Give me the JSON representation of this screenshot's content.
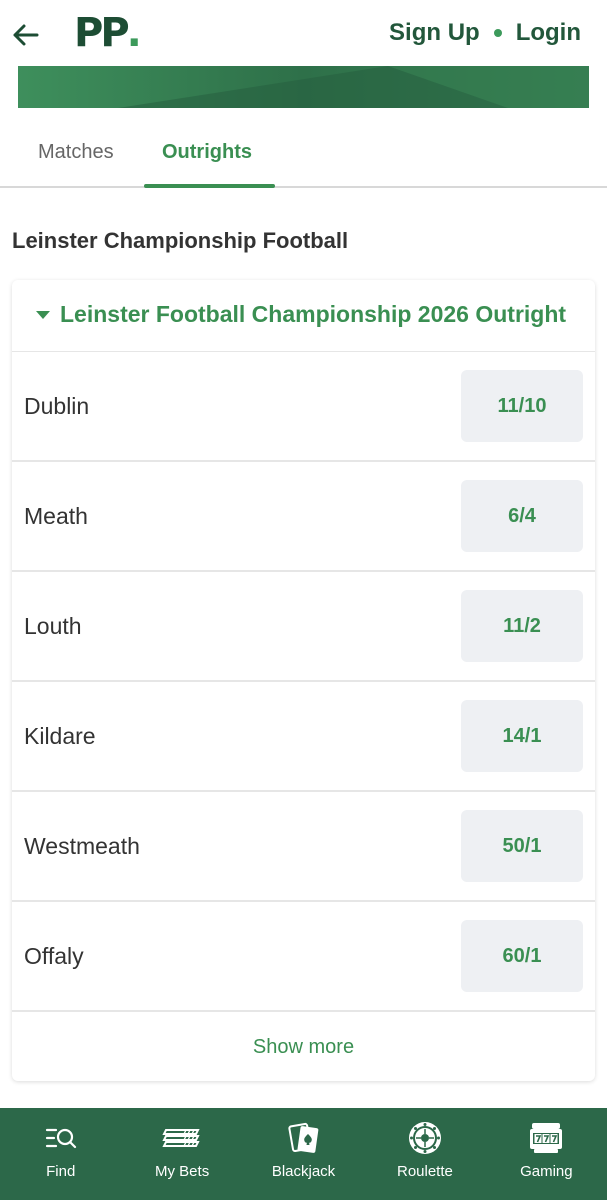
{
  "header": {
    "logo_text": "PP",
    "logo_dot": ".",
    "signup_label": "Sign Up",
    "login_label": "Login"
  },
  "tabs": [
    {
      "label": "Matches",
      "active": false
    },
    {
      "label": "Outrights",
      "active": true
    }
  ],
  "section_title": "Leinster Championship Football",
  "market": {
    "title": "Leinster Football Championship 2026 Outright",
    "selections": [
      {
        "name": "Dublin",
        "odds": "11/10"
      },
      {
        "name": "Meath",
        "odds": "6/4"
      },
      {
        "name": "Louth",
        "odds": "11/2"
      },
      {
        "name": "Kildare",
        "odds": "14/1"
      },
      {
        "name": "Westmeath",
        "odds": "50/1"
      },
      {
        "name": "Offaly",
        "odds": "60/1"
      }
    ],
    "show_more_label": "Show more"
  },
  "bottom_nav": [
    {
      "label": "Find",
      "icon": "find-icon"
    },
    {
      "label": "My Bets",
      "icon": "my-bets-icon"
    },
    {
      "label": "Blackjack",
      "icon": "blackjack-icon"
    },
    {
      "label": "Roulette",
      "icon": "roulette-icon"
    },
    {
      "label": "Gaming",
      "icon": "slot-machine-icon"
    }
  ],
  "colors": {
    "brand_dark": "#1d4d34",
    "brand_green": "#3a8f52",
    "nav_bg": "#2c6849",
    "odds_bg": "#eef0f3"
  }
}
